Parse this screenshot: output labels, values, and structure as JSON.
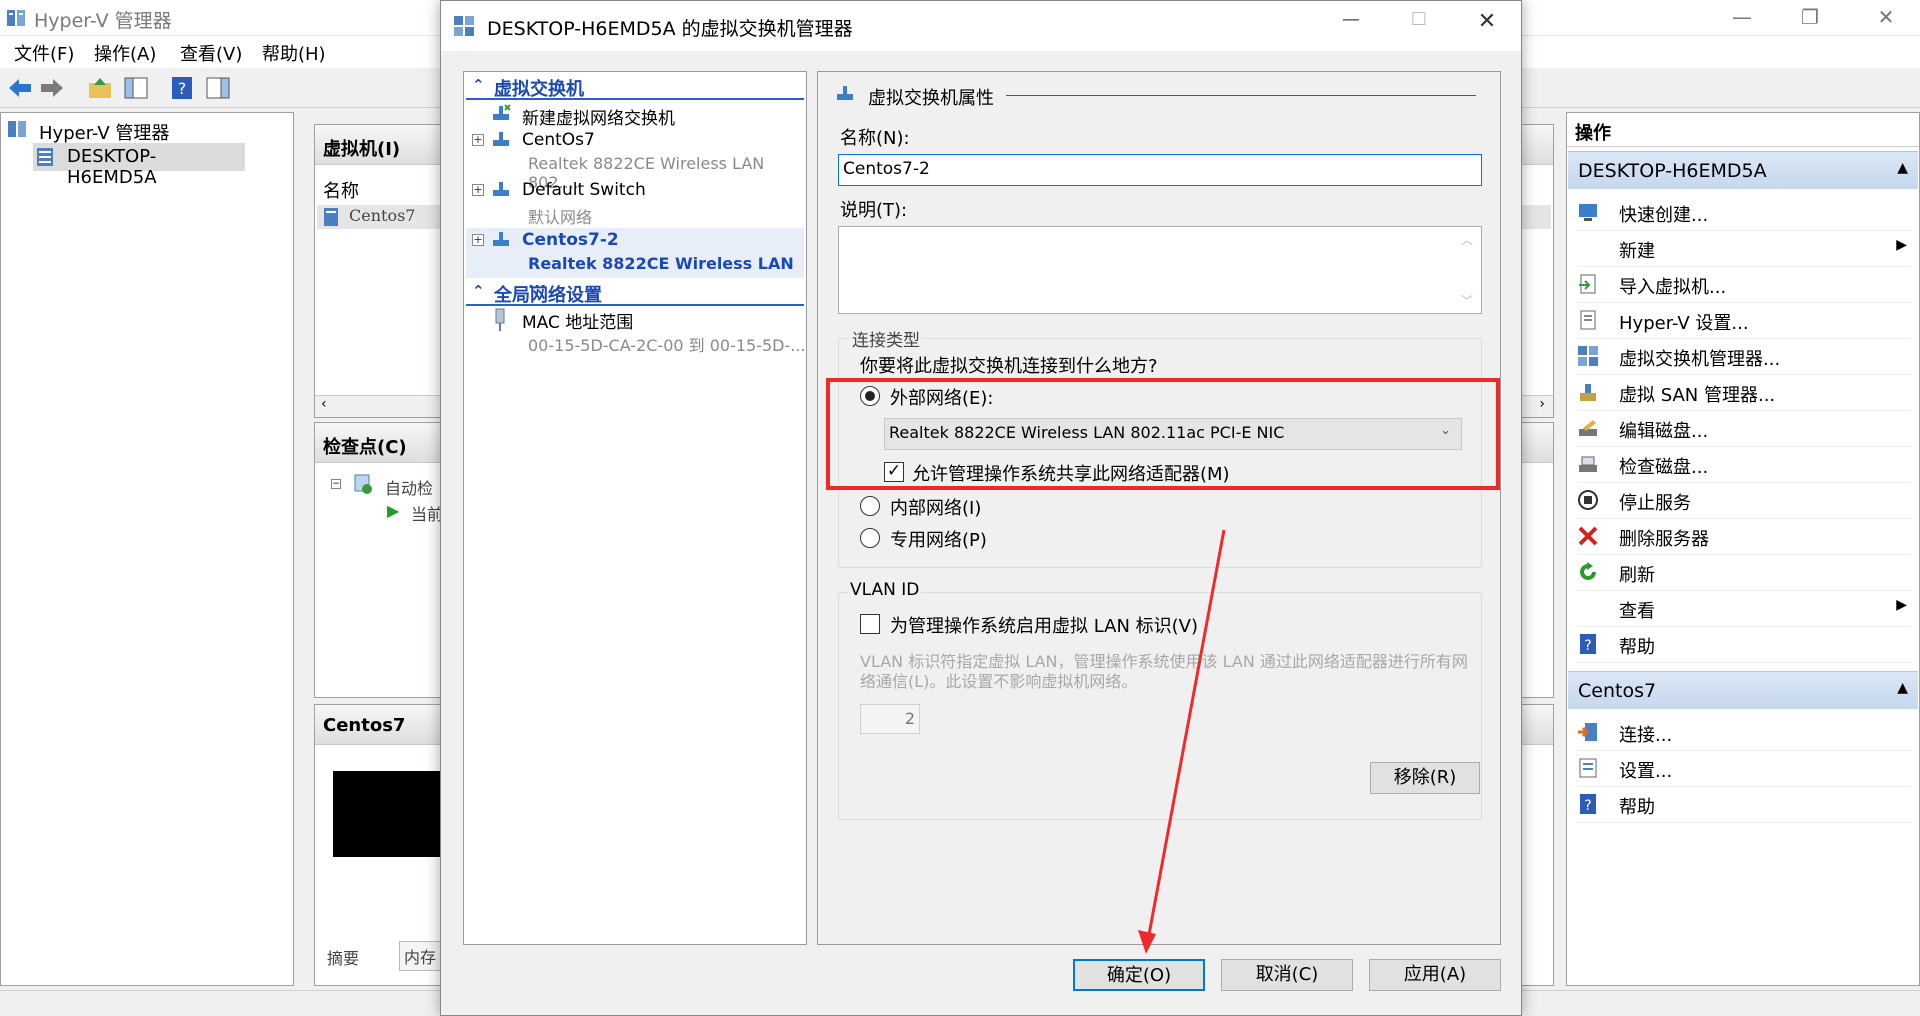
{
  "main_window": {
    "title": "Hyper-V 管理器",
    "menu": [
      "文件(F)",
      "操作(A)",
      "查看(V)",
      "帮助(H)"
    ],
    "nav_tree": {
      "root": "Hyper-V 管理器",
      "server": "DESKTOP-H6EMD5A"
    },
    "vm_pane": {
      "title": "虚拟机(I)",
      "column_name": "名称",
      "vm_name": "Centos7"
    },
    "checkpoint_pane": {
      "title": "检查点(C)",
      "item1": "自动检",
      "item2": "当前"
    },
    "detail_pane": {
      "title": "Centos7",
      "tab1": "摘要",
      "tab2": "内存"
    },
    "actions": {
      "header": "操作",
      "section1": "DESKTOP-H6EMD5A",
      "items1": [
        {
          "icon": "quick-create-icon",
          "label": "快速创建..."
        },
        {
          "icon": "",
          "label": "新建",
          "submenu": true
        },
        {
          "icon": "import-vm-icon",
          "label": "导入虚拟机..."
        },
        {
          "icon": "hyperv-settings-icon",
          "label": "Hyper-V 设置..."
        },
        {
          "icon": "switch-manager-icon",
          "label": "虚拟交换机管理器..."
        },
        {
          "icon": "san-manager-icon",
          "label": "虚拟 SAN 管理器..."
        },
        {
          "icon": "edit-disk-icon",
          "label": "编辑磁盘..."
        },
        {
          "icon": "inspect-disk-icon",
          "label": "检查磁盘..."
        },
        {
          "icon": "stop-service-icon",
          "label": "停止服务"
        },
        {
          "icon": "remove-server-icon",
          "label": "删除服务器"
        },
        {
          "icon": "refresh-icon",
          "label": "刷新"
        },
        {
          "icon": "",
          "label": "查看",
          "submenu": true
        },
        {
          "icon": "help-icon",
          "label": "帮助"
        }
      ],
      "section2": "Centos7",
      "items2": [
        {
          "icon": "connect-icon",
          "label": "连接..."
        },
        {
          "icon": "settings-icon",
          "label": "设置..."
        },
        {
          "icon": "help-icon",
          "label": "帮助"
        }
      ]
    }
  },
  "dialog": {
    "title": "DESKTOP-H6EMD5A 的虚拟交换机管理器",
    "tree": {
      "section_switches": "虚拟交换机",
      "new_switch": "新建虚拟网络交换机",
      "switches": [
        {
          "name": "CentOs7",
          "sub": "Realtek 8822CE Wireless LAN 802...."
        },
        {
          "name": "Default Switch",
          "sub": "默认网络"
        },
        {
          "name": "Centos7-2",
          "sub": "Realtek 8822CE Wireless LAN ...",
          "selected": true
        }
      ],
      "section_global": "全局网络设置",
      "mac_label": "MAC 地址范围",
      "mac_value": "00-15-5D-CA-2C-00 到 00-15-5D-..."
    },
    "props": {
      "header": "虚拟交换机属性",
      "name_label": "名称(N):",
      "name_value": "Centos7-2",
      "desc_label": "说明(T):",
      "conn_type_label": "连接类型",
      "conn_question": "你要将此虚拟交换机连接到什么地方?",
      "external_label": "外部网络(E):",
      "adapter_value": "Realtek 8822CE Wireless LAN 802.11ac PCI-E NIC",
      "share_label": "允许管理操作系统共享此网络适配器(M)",
      "internal_label": "内部网络(I)",
      "private_label": "专用网络(P)",
      "vlan_title": "VLAN ID",
      "vlan_check_label": "为管理操作系统启用虚拟 LAN 标识(V)",
      "vlan_desc": "VLAN 标识符指定虚拟 LAN，管理操作系统使用该 LAN 通过此网络适配器进行所有网络通信(L)。此设置不影响虚拟机网络。",
      "vlan_value": "2",
      "remove_button": "移除(R)"
    },
    "buttons": {
      "ok": "确定(O)",
      "cancel": "取消(C)",
      "apply": "应用(A)"
    },
    "external_selected": true,
    "share_checked": true,
    "vlan_checked": false,
    "annotation_color": "#ee2a2a"
  }
}
